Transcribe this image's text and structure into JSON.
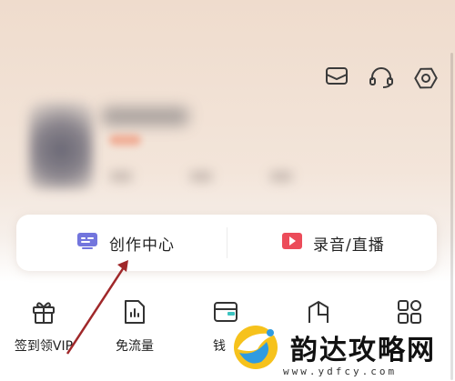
{
  "header": {
    "icons": [
      "mail-icon",
      "headset-icon",
      "settings-icon"
    ]
  },
  "profile": {
    "blurred": true
  },
  "creator_card": {
    "left": {
      "label": "创作中心",
      "icon": "creator-icon",
      "color": "#6b6fd8"
    },
    "right": {
      "label": "录音/直播",
      "icon": "play-icon",
      "color": "#ec4c5a"
    }
  },
  "functions": [
    {
      "label": "签到领VIP",
      "icon": "gift-icon"
    },
    {
      "label": "免流量",
      "icon": "chart-icon"
    },
    {
      "label": "钱",
      "icon": "wallet-icon"
    },
    {
      "label": "",
      "icon": "house-icon"
    },
    {
      "label": "",
      "icon": "grid-icon"
    }
  ],
  "watermark": {
    "brand": "韵达攻略网",
    "url": "www.ydfcy.com"
  },
  "annotation": {
    "arrow_color": "#a0282a"
  }
}
